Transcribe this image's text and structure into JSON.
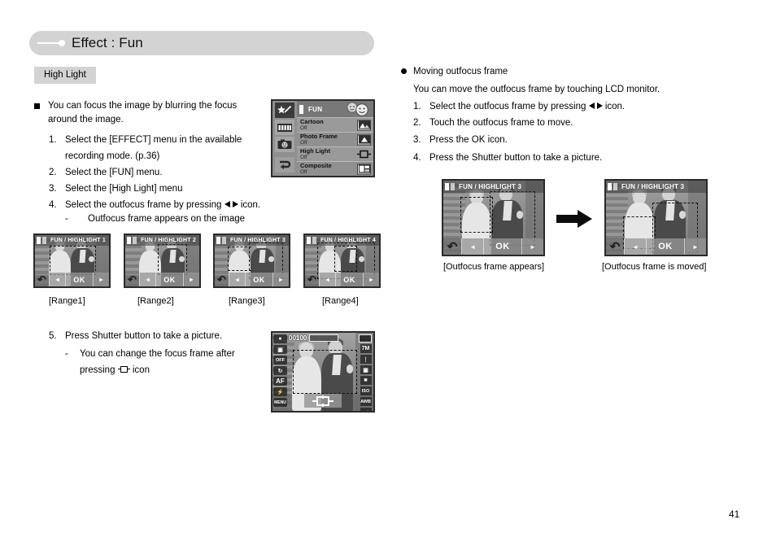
{
  "header": {
    "title": "Effect : Fun",
    "tag": "High Light"
  },
  "left_column": {
    "intro": "You can focus the image by blurring the focus around the image.",
    "steps": [
      {
        "num": "1.",
        "text": "Select the [EFFECT] menu in the available recording mode. (p.36)"
      },
      {
        "num": "2.",
        "text": "Select the [FUN] menu."
      },
      {
        "num": "3.",
        "text": "Select the [High Light] menu"
      },
      {
        "num": "4.",
        "text_before": "Select the outfocus frame by pressing",
        "icon": "left-right-arrows-icon",
        "text_after": "icon."
      }
    ],
    "substep_4": {
      "dash": "-",
      "text": "Outfocus frame appears on the image"
    },
    "step5": {
      "num": "5.",
      "text": "Press Shutter button to take a picture."
    },
    "substep_5": {
      "dash": "-",
      "line1": "You can change the focus frame after",
      "line2_before": "pressing",
      "icon": "high-light-frame-icon",
      "line2_after": "icon"
    }
  },
  "right_column": {
    "bullet_title": "Moving outfocus frame",
    "intro": "You can move the outfocus frame by touching LCD monitor.",
    "steps": [
      {
        "num": "1.",
        "text_before": "Select the outfocus frame by pressing",
        "icon": "left-right-arrows-icon",
        "text_after": "icon."
      },
      {
        "num": "2.",
        "text": "Touch the outfocus frame to move."
      },
      {
        "num": "3.",
        "text": "Press the OK icon."
      },
      {
        "num": "4.",
        "text": "Press the Shutter button to take a picture."
      }
    ]
  },
  "menu_screen": {
    "title": "FUN",
    "sidebar_icons": [
      "magic-wand-star-icon",
      "film-strip-icon",
      "camera-smiley-icon",
      "back-arrow-icon"
    ],
    "rows": [
      {
        "name": "Cartoon",
        "value": "Off",
        "icon": "cartoon-icon"
      },
      {
        "name": "Photo Frame",
        "value": "Off",
        "icon": "photo-frame-icon"
      },
      {
        "name": "High Light",
        "value": "Off",
        "icon": "high-light-frame-icon"
      },
      {
        "name": "Composite",
        "value": "Off",
        "icon": "composite-icon"
      }
    ]
  },
  "range_previews": [
    {
      "header": "FUN / HIGHLIGHT 1",
      "caption": "[Range1]"
    },
    {
      "header": "FUN / HIGHLIGHT 2",
      "caption": "[Range2]"
    },
    {
      "header": "FUN / HIGHLIGHT 3",
      "caption": "[Range3]"
    },
    {
      "header": "FUN / HIGHLIGHT 4",
      "caption": "[Range4]"
    }
  ],
  "lcd_buttons": {
    "back": "back-arrow-icon",
    "left": "left-arrow-icon",
    "ok": "OK",
    "right": "right-arrow-icon"
  },
  "move_previews": [
    {
      "header": "FUN / HIGHLIGHT 3",
      "caption": "[Outfocus frame appears]"
    },
    {
      "header": "FUN / HIGHLIGHT 3",
      "caption": "[Outfocus frame is moved]"
    }
  ],
  "live_view": {
    "shots_remaining": "00100",
    "left_icons": [
      "recording-mode-icon",
      "face-detection-icon",
      "off-icon",
      "self-timer-icon",
      "AF",
      "flash-auto-icon",
      "MENU"
    ],
    "right_icons": [
      "7M",
      "quality-icon",
      "metering-icon",
      "sharpness-icon",
      "ISO",
      "AWB",
      "ev-icon"
    ],
    "highlight_button": "high-light-frame-icon"
  },
  "page_number": "41",
  "colors": {
    "header_pill": "#d3d3d3",
    "tag_bg": "#d3d3d3",
    "text": "#000000",
    "lcd_border": "#2b2b2b"
  }
}
